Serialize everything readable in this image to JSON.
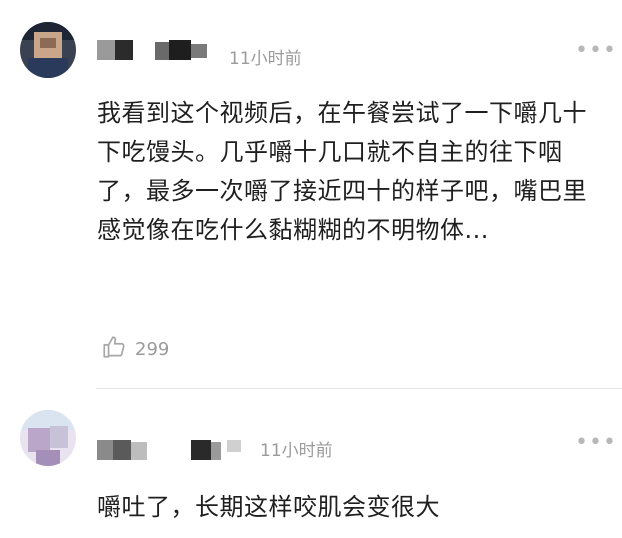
{
  "comments": [
    {
      "time": "11小时前",
      "text": "我看到这个视频后，在午餐尝试了一下嚼几十下吃馒头。几乎嚼十几口就不自主的往下咽了，最多一次嚼了接近四十的样子吧，嘴巴里感觉像在吃什么黏糊糊的不明物体...",
      "likes": "299",
      "more_icon": "more-dots-icon",
      "like_icon": "thumbs-up-icon"
    },
    {
      "time": "11小时前",
      "text": "嚼吐了，长期这样咬肌会变很大",
      "more_icon": "more-dots-icon"
    }
  ],
  "colors": {
    "text": "#1f1f1f",
    "meta": "#9b9b9b",
    "divider": "#e6e6e6"
  }
}
